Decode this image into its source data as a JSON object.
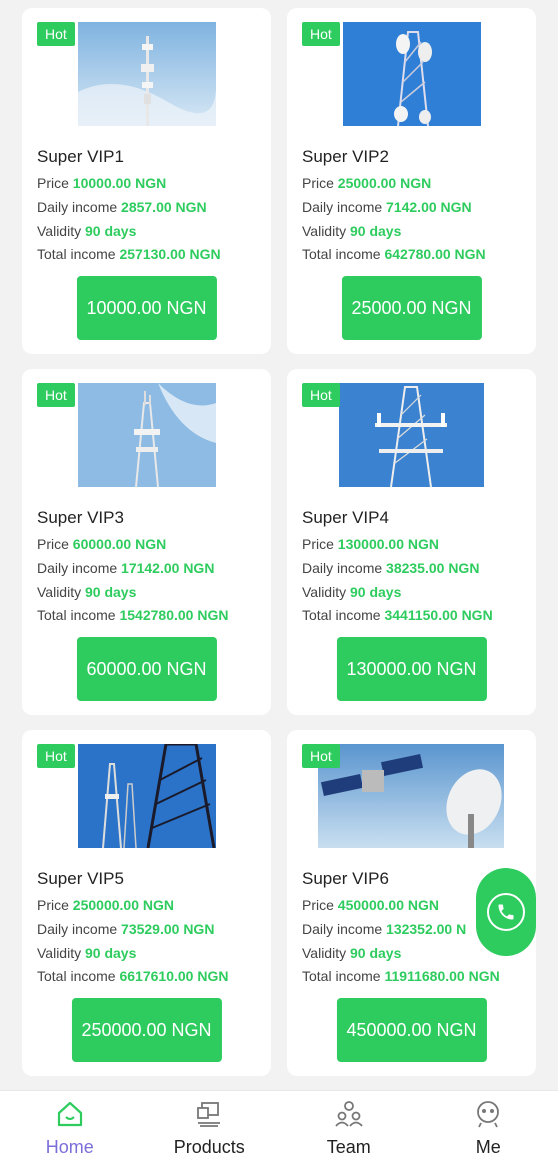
{
  "products": [
    {
      "badge": "Hot",
      "title": "Super VIP1",
      "price_label": "Price",
      "price": "10000.00 NGN",
      "daily_label": "Daily income",
      "daily": "2857.00 NGN",
      "validity_label": "Validity",
      "validity": "90 days",
      "total_label": "Total income",
      "total": "257130.00 NGN",
      "button": "10000.00 NGN"
    },
    {
      "badge": "Hot",
      "title": "Super VIP2",
      "price_label": "Price",
      "price": "25000.00 NGN",
      "daily_label": "Daily income",
      "daily": "7142.00 NGN",
      "validity_label": "Validity",
      "validity": "90 days",
      "total_label": "Total income",
      "total": "642780.00 NGN",
      "button": "25000.00 NGN"
    },
    {
      "badge": "Hot",
      "title": "Super VIP3",
      "price_label": "Price",
      "price": "60000.00 NGN",
      "daily_label": "Daily income",
      "daily": "17142.00 NGN",
      "validity_label": "Validity",
      "validity": "90 days",
      "total_label": "Total income",
      "total": "1542780.00 NGN",
      "button": "60000.00 NGN"
    },
    {
      "badge": "Hot",
      "title": "Super VIP4",
      "price_label": "Price",
      "price": "130000.00 NGN",
      "daily_label": "Daily income",
      "daily": "38235.00 NGN",
      "validity_label": "Validity",
      "validity": "90 days",
      "total_label": "Total income",
      "total": "3441150.00 NGN",
      "button": "130000.00 NGN"
    },
    {
      "badge": "Hot",
      "title": "Super VIP5",
      "price_label": "Price",
      "price": "250000.00 NGN",
      "daily_label": "Daily income",
      "daily": "73529.00 NGN",
      "validity_label": "Validity",
      "validity": "90 days",
      "total_label": "Total income",
      "total": "6617610.00 NGN",
      "button": "250000.00 NGN"
    },
    {
      "badge": "Hot",
      "title": "Super VIP6",
      "price_label": "Price",
      "price": "450000.00 NGN",
      "daily_label": "Daily income",
      "daily": "132352.00 N",
      "validity_label": "Validity",
      "validity": "90 days",
      "total_label": "Total income",
      "total": "11911680.00 NGN",
      "button": "450000.00 NGN"
    }
  ],
  "tabbar": {
    "home": "Home",
    "products": "Products",
    "team": "Team",
    "me": "Me"
  },
  "colors": {
    "accent": "#2ecc5e",
    "active_tab": "#7a6fd8"
  },
  "icons": {
    "fab": "phone-icon",
    "home": "home-icon",
    "products": "products-icon",
    "team": "team-icon",
    "me": "me-icon"
  }
}
